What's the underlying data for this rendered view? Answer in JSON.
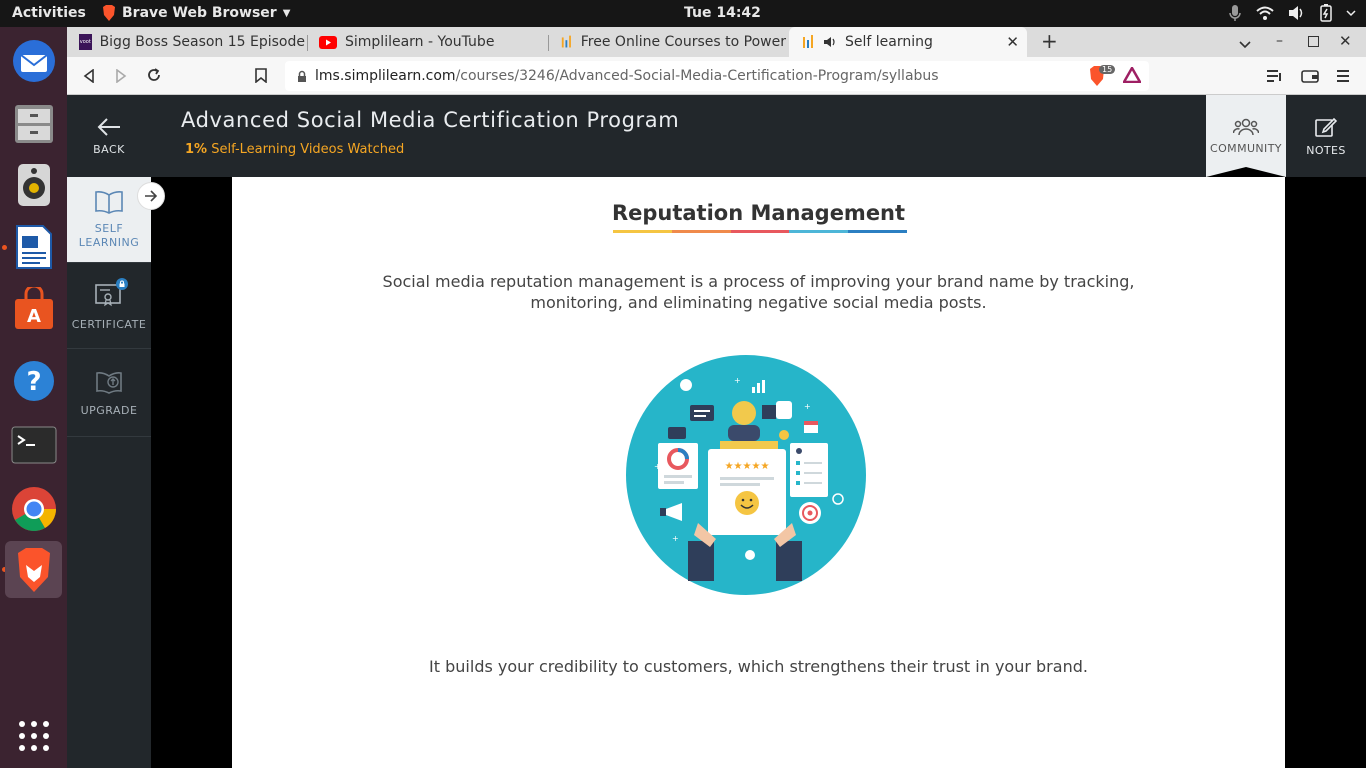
{
  "topbar": {
    "activities": "Activities",
    "app_name": "Brave Web Browser",
    "clock": "Tue 14:42"
  },
  "tabs": [
    {
      "label": "Bigg Boss Season 15 Episode",
      "favicon": "voot"
    },
    {
      "label": "Simplilearn - YouTube",
      "favicon": "youtube"
    },
    {
      "label": "Free Online Courses to Power",
      "favicon": "simplilearn"
    },
    {
      "label": "Self learning",
      "favicon": "simplilearn",
      "active": true
    }
  ],
  "address": {
    "host": "lms.simplilearn.com",
    "path": "/courses/3246/Advanced-Social-Media-Certification-Program/syllabus",
    "shields_count": "15"
  },
  "header": {
    "back_label": "BACK",
    "course_title": "Advanced Social Media Certification Program",
    "progress_pct": "1%",
    "progress_text": "Self-Learning Videos Watched",
    "community_label": "COMMUNITY",
    "notes_label": "NOTES"
  },
  "leftnav": {
    "self_learning_1": "SELF",
    "self_learning_2": "LEARNING",
    "certificate": "CERTIFICATE",
    "upgrade": "UPGRADE"
  },
  "slide": {
    "title": "Reputation Management",
    "paragraph1": "Social media reputation management is a process of improving your brand name by tracking, monitoring, and eliminating negative social media posts.",
    "paragraph2": "It builds your credibility to customers, which strengthens their trust in your brand.",
    "underline_colors": [
      "#f5c542",
      "#f08a4b",
      "#e8585e",
      "#4db6d8",
      "#2b7fc2"
    ]
  },
  "colors": {
    "accent_orange": "#f5a623",
    "header_bg": "#22272b",
    "illustration_bg": "#26b5c9"
  }
}
